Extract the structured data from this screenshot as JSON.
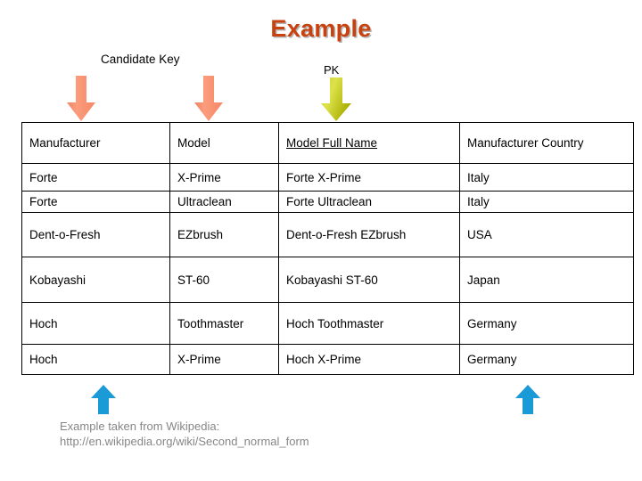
{
  "slide": {
    "title": "Example",
    "title_color": "#C8420F",
    "background": "#ffffff"
  },
  "annotations": {
    "candidate_key": {
      "label": "Candidate Key",
      "arrow_color": "#F99272",
      "arrow_direction": "down",
      "count": 2
    },
    "primary_key": {
      "label": "PK",
      "arrow_color": "#C6CC16",
      "arrow_direction": "down",
      "count": 1
    },
    "bottom_markers": {
      "arrow_color": "#1B9AD8",
      "arrow_direction": "up",
      "count": 2
    }
  },
  "table": {
    "headers": [
      "Manufacturer",
      "Model",
      "Model Full Name",
      "Manufacturer Country"
    ],
    "primary_key_header_index": 2,
    "rows": [
      [
        "Forte",
        "X-Prime",
        "Forte X-Prime",
        "Italy"
      ],
      [
        "Forte",
        "Ultraclean",
        "Forte Ultraclean",
        "Italy"
      ],
      [
        "Dent-o-Fresh",
        "EZbrush",
        "Dent-o-Fresh EZbrush",
        "USA"
      ],
      [
        "Kobayashi",
        "ST-60",
        "Kobayashi ST-60",
        "Japan"
      ],
      [
        "Hoch",
        "Toothmaster",
        "Hoch Toothmaster",
        "Germany"
      ],
      [
        "Hoch",
        "X-Prime",
        "Hoch X-Prime",
        "Germany"
      ]
    ]
  },
  "caption": {
    "line1": "Example taken from Wikipedia:",
    "line2": "http://en.wikipedia.org/wiki/Second_normal_form",
    "color": "#868686"
  }
}
